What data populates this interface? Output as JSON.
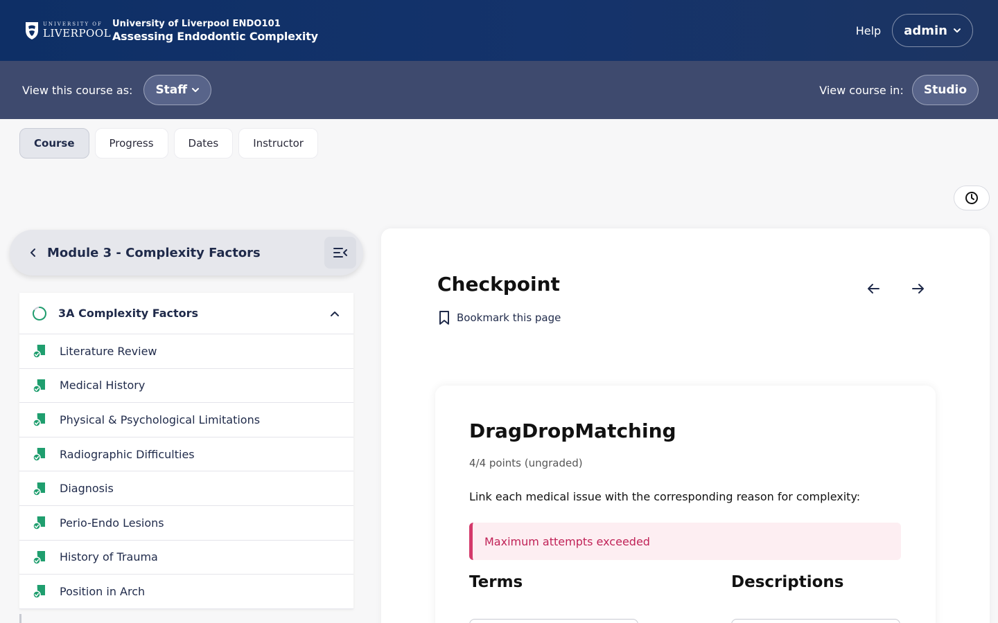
{
  "header": {
    "logo_small": "UNIVERSITY OF",
    "logo_big": "LIVERPOOL",
    "course_org": "University of Liverpool ENDO101",
    "course_name": "Assessing Endodontic Complexity",
    "help": "Help",
    "user": "admin"
  },
  "viewbar": {
    "view_as_label": "View this course as:",
    "view_as_value": "Staff",
    "view_in_label": "View course in:",
    "view_in_value": "Studio"
  },
  "tabs": [
    "Course",
    "Progress",
    "Dates",
    "Instructor"
  ],
  "active_tab": "Course",
  "sidebar": {
    "module_title": "Module 3 - Complexity Factors",
    "section_title": "3A Complexity Factors",
    "units": [
      "Literature Review",
      "Medical History",
      "Physical & Psychological Limitations",
      "Radiographic Difficulties",
      "Diagnosis",
      "Perio-Endo Lesions",
      "History of Trauma",
      "Position in Arch"
    ]
  },
  "unit": {
    "title": "Checkpoint",
    "bookmark": "Bookmark this page"
  },
  "problem": {
    "title": "DragDropMatching",
    "points": "4/4 points (ungraded)",
    "prompt": "Link each medical issue with the corresponding reason for complexity:",
    "alert": "Maximum attempts exceeded",
    "terms_heading": "Terms",
    "descriptions_heading": "Descriptions"
  },
  "colors": {
    "header_bg": "#0e2f66",
    "viewbar_bg": "#3e4a6e",
    "complete_icon": "#1f9e6e",
    "alert_accent": "#d43a6b"
  }
}
